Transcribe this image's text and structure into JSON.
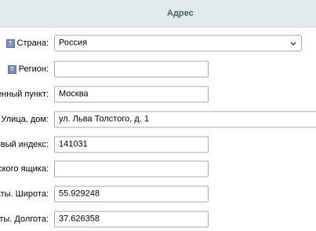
{
  "section": {
    "title": "Адрес"
  },
  "fields": {
    "country": {
      "label": "Страна:",
      "value": "Россия",
      "help_icon": "help-icon"
    },
    "region": {
      "label": "Регион:",
      "value": "",
      "help_icon": "help-icon"
    },
    "locality": {
      "label": "енный пункт:",
      "value": "Москва"
    },
    "street": {
      "label": "Улица, дом:",
      "value": "ул. Льва Толстого, д. 1"
    },
    "postal_code": {
      "label": "овый индекс:",
      "value": "141031"
    },
    "po_box": {
      "label": "ского ящика:",
      "value": ""
    },
    "latitude": {
      "label": "аты. Широта:",
      "value": "55.929248"
    },
    "longitude": {
      "label": "аты. Долгота:",
      "value": "37.626358"
    }
  },
  "colors": {
    "header_bg": "#e1e9ea",
    "header_text": "#4b6267",
    "help_icon": "#7b8fb8"
  }
}
